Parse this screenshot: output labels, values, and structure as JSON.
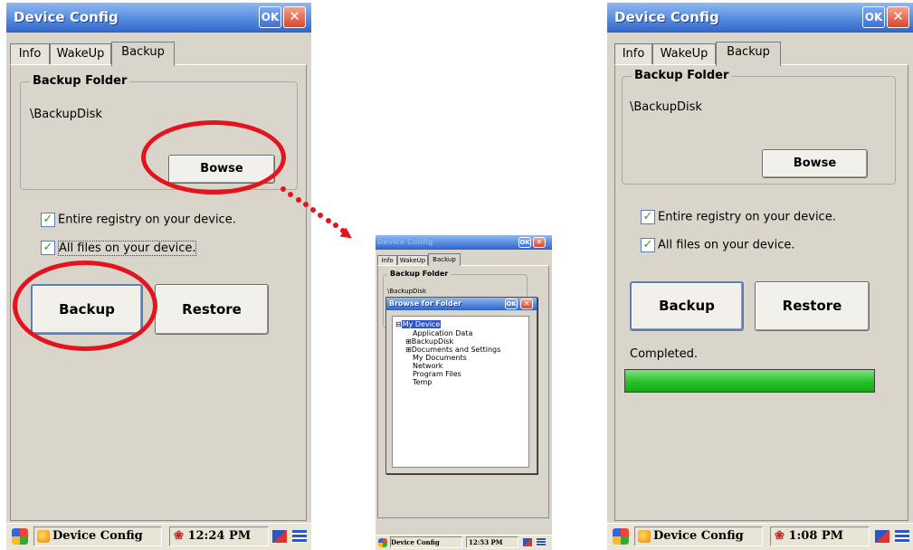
{
  "left_screen": {
    "window_title": "Device Config",
    "ok_label": "OK",
    "close_glyph": "✕",
    "tabs": [
      "Info",
      "WakeUp",
      "Backup"
    ],
    "group_title": "Backup Folder",
    "backup_path": "\\BackupDisk",
    "browse_label": "Bowse",
    "options": [
      "Entire registry on your device.",
      "All files on your device."
    ],
    "backup_label": "Backup",
    "restore_label": "Restore",
    "taskbar_app": "Device Config",
    "clock": "12:24 PM"
  },
  "middle_screen": {
    "window_title": "Device Config",
    "ok_label": "OK",
    "close_glyph": "✕",
    "tabs": [
      "Info",
      "WakeUp",
      "Backup"
    ],
    "group_title": "Backup Folder",
    "backup_path": "\\BackupDisk",
    "dialog_title": "Browse for Folder",
    "tree": [
      {
        "prefix": "⊟",
        "label": "My Device",
        "selected": true
      },
      {
        "prefix": "",
        "label": "Application Data",
        "selected": false
      },
      {
        "prefix": "⊞",
        "label": "BackupDisk",
        "selected": false
      },
      {
        "prefix": "⊞",
        "label": "Documents and Settings",
        "selected": false
      },
      {
        "prefix": "",
        "label": "My Documents",
        "selected": false
      },
      {
        "prefix": "",
        "label": "Network",
        "selected": false
      },
      {
        "prefix": "",
        "label": "Program Files",
        "selected": false
      },
      {
        "prefix": "",
        "label": "Temp",
        "selected": false
      }
    ],
    "taskbar_app": "Device Config",
    "clock": "12:53 PM"
  },
  "right_screen": {
    "window_title": "Device Config",
    "ok_label": "OK",
    "close_glyph": "✕",
    "tabs": [
      "Info",
      "WakeUp",
      "Backup"
    ],
    "group_title": "Backup Folder",
    "backup_path": "\\BackupDisk",
    "browse_label": "Bowse",
    "options": [
      "Entire registry on your device.",
      "All files on your device."
    ],
    "backup_label": "Backup",
    "restore_label": "Restore",
    "status": "Completed.",
    "progress_fraction": 1.0,
    "taskbar_app": "Device Config",
    "clock": "1:08 PM"
  },
  "colors": {
    "annotation_red": "#e3141e",
    "titlebar_blue": "#2f64c8",
    "progress_green": "#27c227",
    "panel_bg": "#d9d5ca"
  }
}
